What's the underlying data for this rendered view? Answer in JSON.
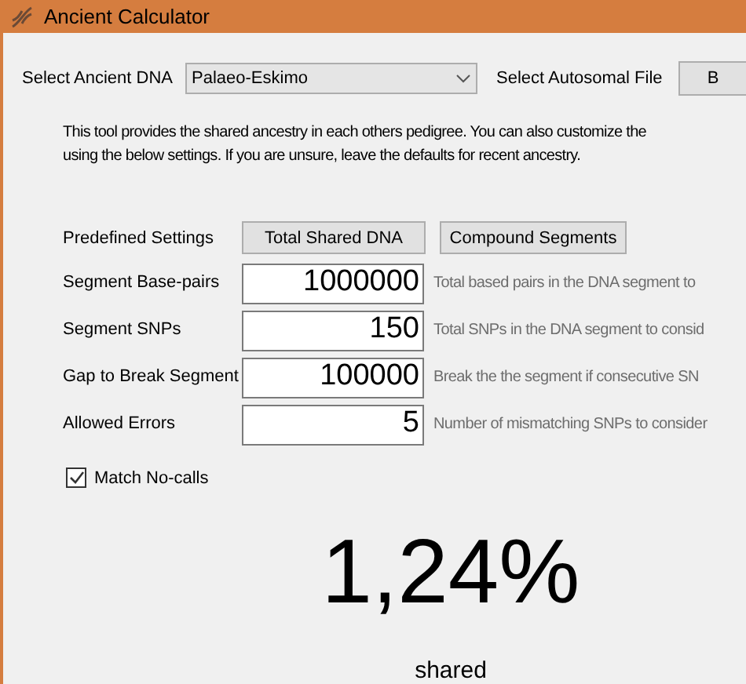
{
  "window": {
    "title": "Ancient Calculator"
  },
  "ancient_dna": {
    "label": "Select Ancient DNA",
    "value": "Palaeo-Eskimo"
  },
  "autosomal_file": {
    "label": "Select Autosomal File",
    "button": "B"
  },
  "description": "This tool provides the shared ancestry in each others pedigree. You can also customize the\nusing the below settings. If you are unsure, leave the defaults for recent ancestry.",
  "predefined": {
    "label": "Predefined Settings",
    "buttons": [
      "Total Shared DNA",
      "Compound Segments"
    ]
  },
  "settings": [
    {
      "label": "Segment Base-pairs",
      "value": "1000000",
      "hint": "Total based pairs in the DNA segment to"
    },
    {
      "label": "Segment SNPs",
      "value": "150",
      "hint": "Total SNPs in the DNA segment to consid"
    },
    {
      "label": "Gap to Break Segment",
      "value": "100000",
      "hint": "Break the the segment if consecutive SN"
    },
    {
      "label": "Allowed Errors",
      "value": "5",
      "hint": "Number of mismatching SNPs to consider"
    }
  ],
  "match_no_calls": {
    "label": "Match No-calls",
    "checked": true
  },
  "result": {
    "value": "1,24%",
    "caption": "shared"
  }
}
